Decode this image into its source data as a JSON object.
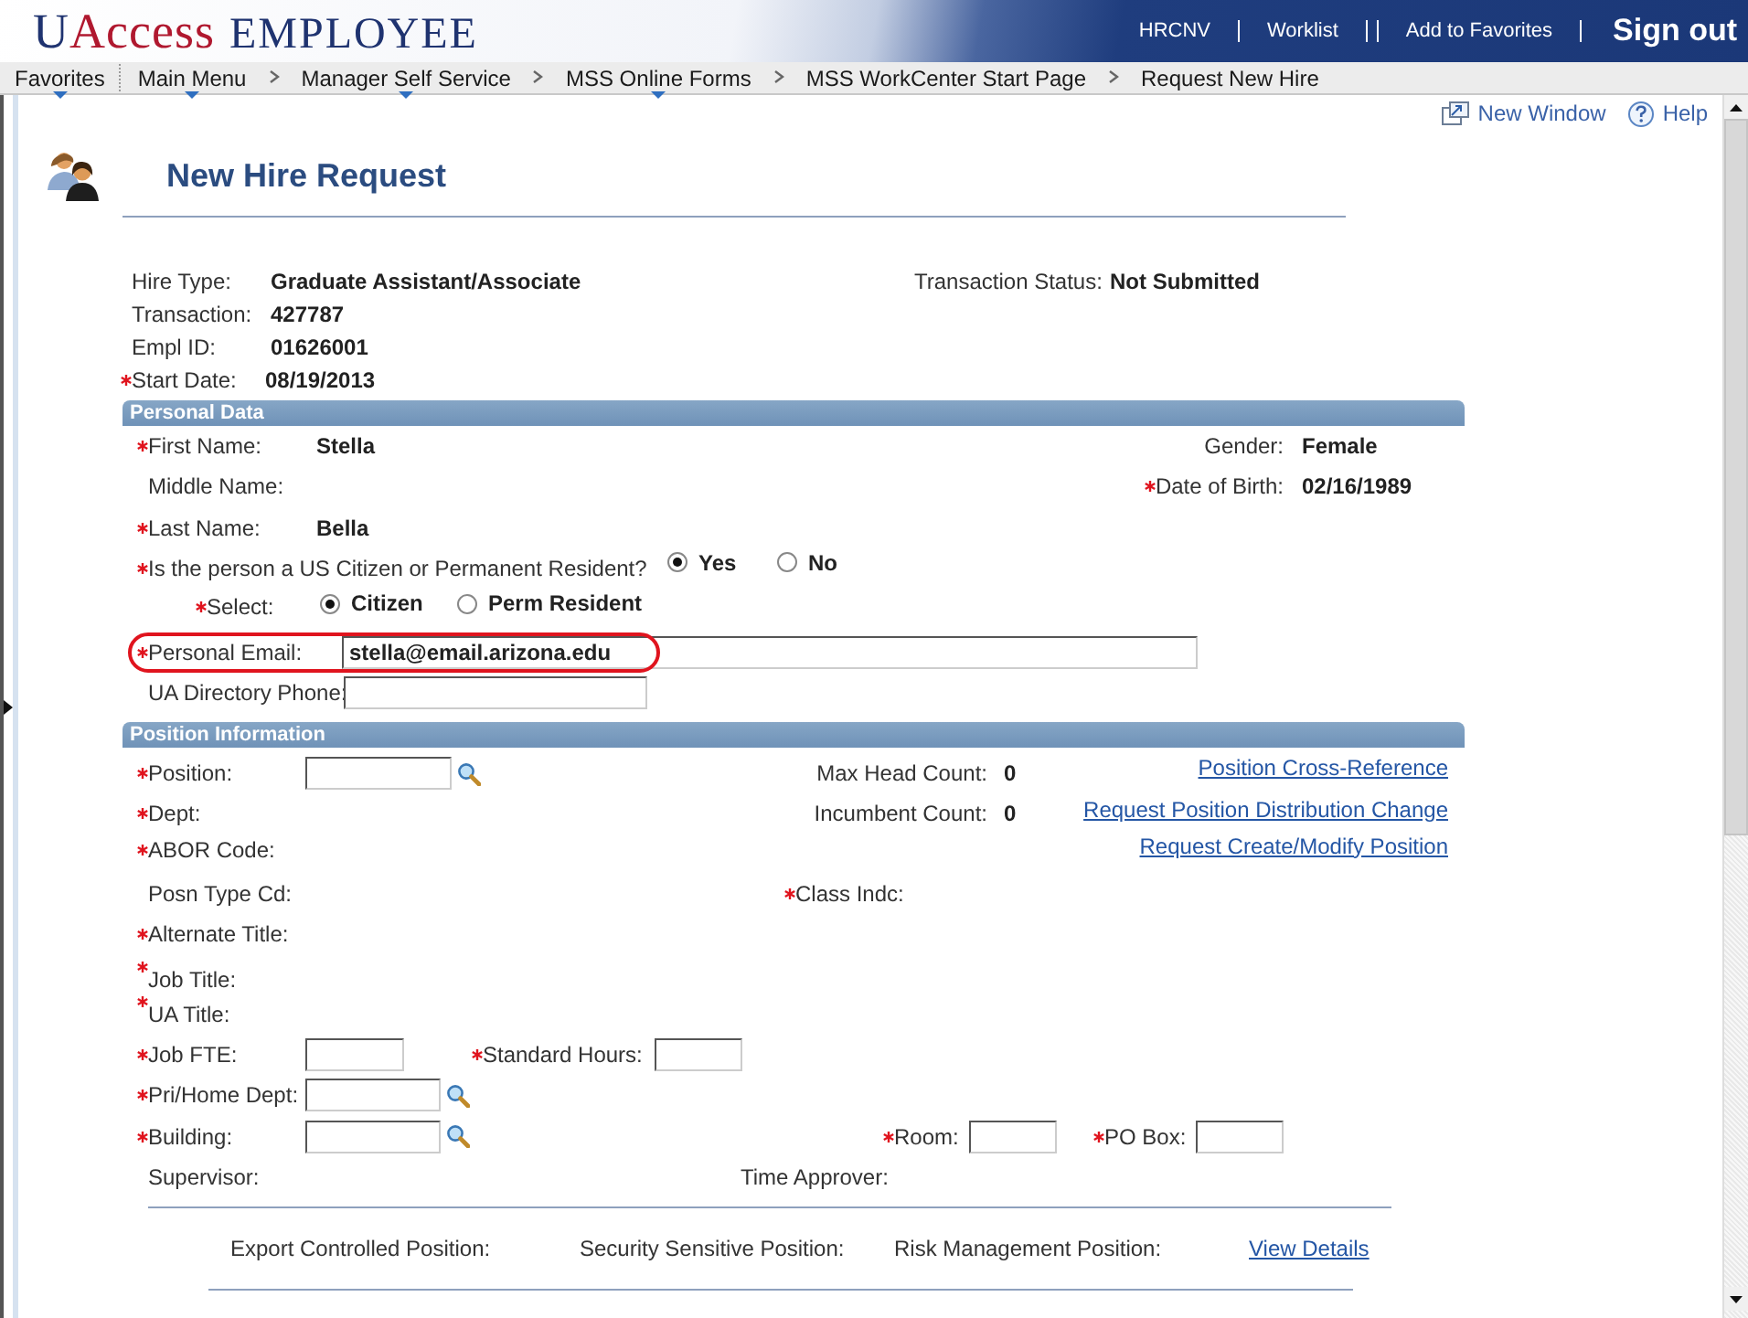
{
  "header": {
    "logo": {
      "lead": "U",
      "accent": "Access",
      "name": "EMPLOYEE"
    },
    "links": [
      "HRCNV",
      "Worklist",
      "Add to Favorites"
    ],
    "sign_out": "Sign out"
  },
  "breadcrumbs": [
    {
      "label": "Favorites",
      "menu": true
    },
    {
      "label": "Main Menu",
      "menu": true
    },
    {
      "label": "Manager Self Service",
      "menu": true
    },
    {
      "label": "MSS Online Forms",
      "menu": true
    },
    {
      "label": "MSS WorkCenter Start Page",
      "menu": false
    },
    {
      "label": "Request New Hire",
      "menu": false
    }
  ],
  "toolbar": {
    "new_window": "New Window",
    "help": "Help"
  },
  "title": "New Hire Request",
  "summary": {
    "hire_type": {
      "label": "Hire Type:",
      "value": "Graduate Assistant/Associate"
    },
    "transaction": {
      "label": "Transaction:",
      "value": "427787"
    },
    "empl_id": {
      "label": "Empl ID:",
      "value": "01626001"
    },
    "start_date": {
      "label": "Start Date:",
      "value": "08/19/2013",
      "required": true
    },
    "status": {
      "label": "Transaction Status:",
      "value": "Not Submitted"
    }
  },
  "personal_data": {
    "heading": "Personal Data",
    "first_name": {
      "label": "First Name:",
      "value": "Stella",
      "required": true
    },
    "gender": {
      "label": "Gender:",
      "value": "Female"
    },
    "middle_name": {
      "label": "Middle Name:"
    },
    "date_of_birth": {
      "label": "Date of Birth:",
      "value": "02/16/1989",
      "required": true
    },
    "last_name": {
      "label": "Last Name:",
      "value": "Bella",
      "required": true
    },
    "citizen_question": {
      "label": "Is the person a US Citizen or Permanent Resident?",
      "required": true,
      "options": [
        {
          "label": "Yes",
          "selected": true
        },
        {
          "label": "No",
          "selected": false
        }
      ]
    },
    "select": {
      "label": "Select:",
      "required": true,
      "options": [
        {
          "label": "Citizen",
          "selected": true
        },
        {
          "label": "Perm Resident",
          "selected": false
        }
      ]
    },
    "personal_email": {
      "label": "Personal Email:",
      "value": "stella@email.arizona.edu",
      "required": true,
      "highlighted": true
    },
    "directory_phone": {
      "label": "UA Directory Phone:"
    }
  },
  "position_info": {
    "heading": "Position Information",
    "position": {
      "label": "Position:",
      "required": true
    },
    "max_head_count": {
      "label": "Max Head Count:",
      "value": "0"
    },
    "dept": {
      "label": "Dept:",
      "required": true
    },
    "incumbent_count": {
      "label": "Incumbent Count:",
      "value": "0"
    },
    "abor_code": {
      "label": "ABOR Code:",
      "required": true
    },
    "links": [
      "Position Cross-Reference",
      "Request Position Distribution Change",
      "Request Create/Modify Position"
    ],
    "posn_type_cd": {
      "label": "Posn Type Cd:"
    },
    "class_indc": {
      "label": "Class Indc:",
      "required": true
    },
    "alternate_title": {
      "label": "Alternate Title:",
      "required": true
    },
    "job_title": {
      "label": "Job Title:",
      "required": true
    },
    "ua_title": {
      "label": "UA Title:",
      "required": true
    },
    "job_fte": {
      "label": "Job FTE:",
      "required": true
    },
    "standard_hours": {
      "label": "Standard Hours:",
      "required": true
    },
    "pri_home_dept": {
      "label": "Pri/Home Dept:",
      "required": true
    },
    "building": {
      "label": "Building:",
      "required": true
    },
    "room": {
      "label": "Room:",
      "required": true
    },
    "po_box": {
      "label": "PO Box:",
      "required": true
    },
    "supervisor": {
      "label": "Supervisor:"
    },
    "time_approver": {
      "label": "Time Approver:"
    }
  },
  "flags": {
    "items": [
      "Export Controlled Position:",
      "Security Sensitive Position:",
      "Risk Management Position:"
    ],
    "link": "View Details"
  }
}
